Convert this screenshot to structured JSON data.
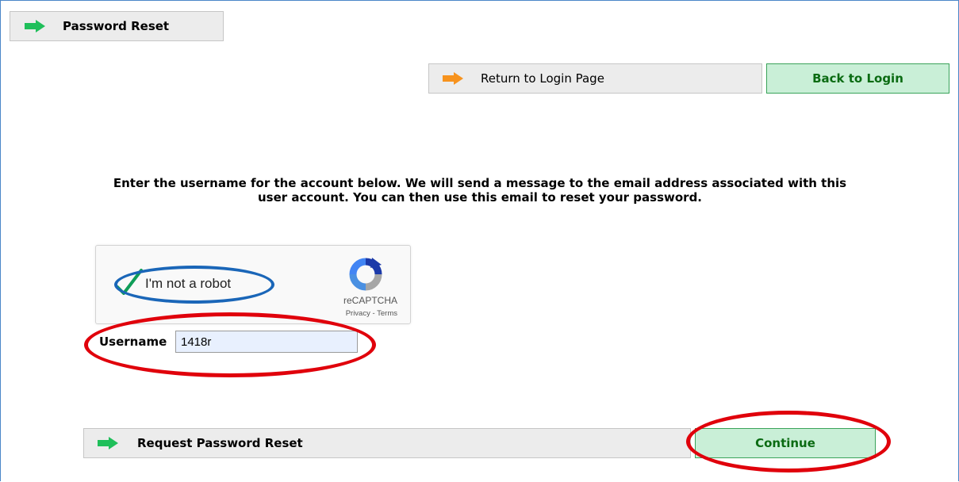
{
  "header": {
    "title": "Password Reset"
  },
  "nav": {
    "return_label": "Return to Login Page",
    "back_button": "Back to Login"
  },
  "instructions": {
    "line1": "Enter the username for the account below. We will send a message to the email address associated with this",
    "line2": "user account. You can then use this email to reset your password."
  },
  "captcha": {
    "label": "I'm not a robot",
    "checked": true,
    "brand": "reCAPTCHA",
    "privacy": "Privacy",
    "separator": "-",
    "terms": "Terms"
  },
  "form": {
    "username_label": "Username",
    "username_value": "1418r"
  },
  "footer": {
    "request_label": "Request Password Reset",
    "continue_button": "Continue"
  },
  "colors": {
    "green_arrow": "#1fbf5a",
    "orange_arrow": "#f7931e",
    "highlight_red": "#e0000b",
    "highlight_blue": "#1a66b8",
    "button_text": "#0a6b12"
  }
}
